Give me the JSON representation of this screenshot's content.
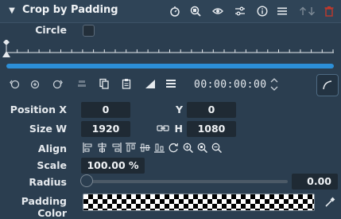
{
  "header": {
    "title": "Crop by Padding"
  },
  "circle": {
    "label": "Circle"
  },
  "toolbar": {
    "timecode": "00:00:00:00"
  },
  "position": {
    "x_label": "Position X",
    "x_value": "0",
    "y_label": "Y",
    "y_value": "0"
  },
  "size": {
    "w_label": "Size W",
    "w_value": "1920",
    "h_label": "H",
    "h_value": "1080"
  },
  "align": {
    "label": "Align"
  },
  "scale": {
    "label": "Scale",
    "value": "100.00 %"
  },
  "radius": {
    "label": "Radius",
    "value": "0.00",
    "level": 0
  },
  "padding": {
    "label": "Padding Color"
  },
  "colors": {
    "accent": "#2c8fd8",
    "background": "#2b3e50",
    "field": "#1f2a34",
    "delete": "#c0392b"
  }
}
